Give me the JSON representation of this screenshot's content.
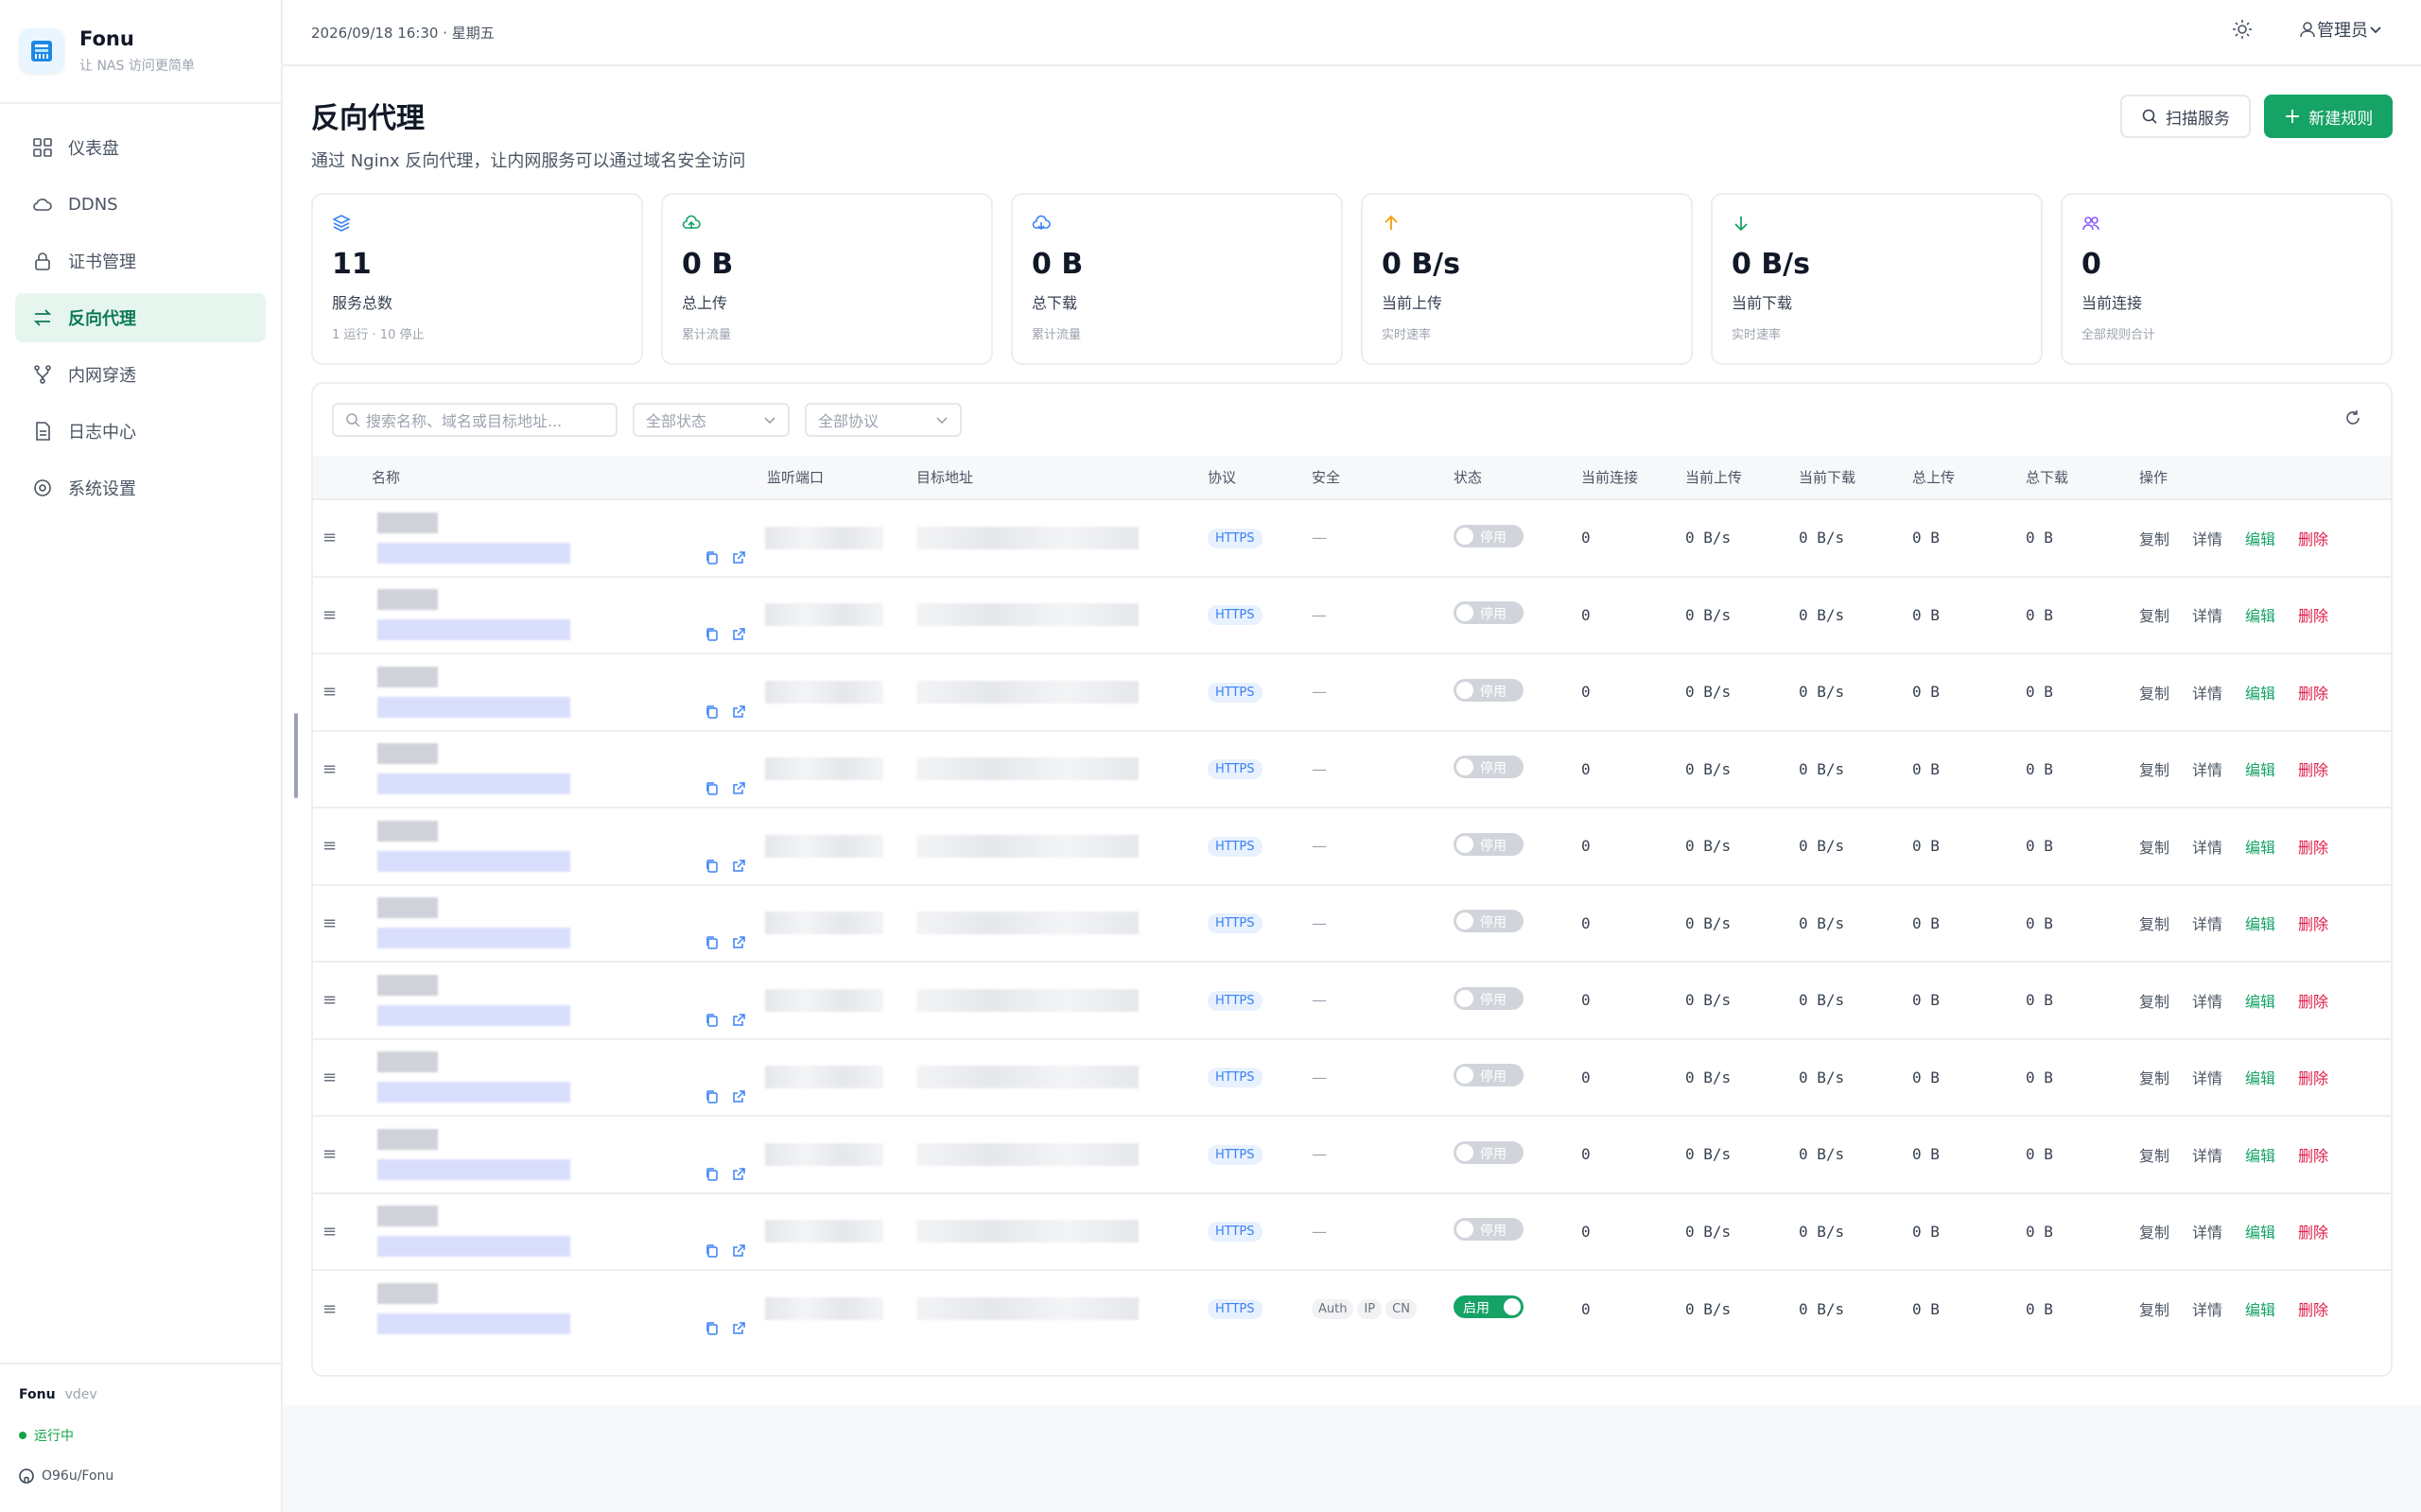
{
  "app": {
    "name": "Fonu",
    "tagline": "让 NAS 访问更简单"
  },
  "nav": [
    {
      "label": "仪表盘",
      "icon": "dashboard-icon"
    },
    {
      "label": "DDNS",
      "icon": "cloud-icon"
    },
    {
      "label": "证书管理",
      "icon": "lock-icon"
    },
    {
      "label": "反向代理",
      "icon": "swap-icon",
      "active": true
    },
    {
      "label": "内网穿透",
      "icon": "branch-icon"
    },
    {
      "label": "日志中心",
      "icon": "document-icon"
    },
    {
      "label": "系统设置",
      "icon": "gear-icon"
    }
  ],
  "footer": {
    "name": "Fonu",
    "version": "vdev",
    "status": "运行中",
    "repo": "O96u/Fonu"
  },
  "topbar": {
    "datetime": "2026/09/18 16:30 · 星期五",
    "user": "管理员"
  },
  "page": {
    "title": "反向代理",
    "subtitle": "通过 Nginx 反向代理，让内网服务可以通过域名安全访问",
    "scan_label": "扫描服务",
    "new_label": "新建规则"
  },
  "stats": [
    {
      "value": "11",
      "label": "服务总数",
      "sub": "1 运行 · 10 停止",
      "icon": "layers-icon",
      "color": "#3b82f6"
    },
    {
      "value": "0 B",
      "label": "总上传",
      "sub": "累计流量",
      "icon": "cloud-upload-icon",
      "color": "#16a366"
    },
    {
      "value": "0 B",
      "label": "总下载",
      "sub": "累计流量",
      "icon": "cloud-download-icon",
      "color": "#3b82f6"
    },
    {
      "value": "0 B/s",
      "label": "当前上传",
      "sub": "实时速率",
      "icon": "arrow-up-icon",
      "color": "#f59e0b"
    },
    {
      "value": "0 B/s",
      "label": "当前下载",
      "sub": "实时速率",
      "icon": "arrow-down-icon",
      "color": "#16a366"
    },
    {
      "value": "0",
      "label": "当前连接",
      "sub": "全部规则合计",
      "icon": "users-icon",
      "color": "#8b5cf6"
    }
  ],
  "filters": {
    "search_placeholder": "搜索名称、域名或目标地址...",
    "status": "全部状态",
    "protocol": "全部协议"
  },
  "table": {
    "columns": [
      "名称",
      "监听端口",
      "目标地址",
      "协议",
      "安全",
      "状态",
      "当前连接",
      "当前上传",
      "当前下载",
      "总上传",
      "总下载",
      "操作"
    ],
    "actions": {
      "copy": "复制",
      "detail": "详情",
      "edit": "编辑",
      "delete": "删除"
    },
    "rows": [
      {
        "protocol": "HTTPS",
        "security": "—",
        "status": "停用",
        "enabled": false,
        "conn": "0",
        "up": "0 B/s",
        "down": "0 B/s",
        "total_up": "0 B",
        "total_down": "0 B"
      },
      {
        "protocol": "HTTPS",
        "security": "—",
        "status": "停用",
        "enabled": false,
        "conn": "0",
        "up": "0 B/s",
        "down": "0 B/s",
        "total_up": "0 B",
        "total_down": "0 B"
      },
      {
        "protocol": "HTTPS",
        "security": "—",
        "status": "停用",
        "enabled": false,
        "conn": "0",
        "up": "0 B/s",
        "down": "0 B/s",
        "total_up": "0 B",
        "total_down": "0 B"
      },
      {
        "protocol": "HTTPS",
        "security": "—",
        "status": "停用",
        "enabled": false,
        "conn": "0",
        "up": "0 B/s",
        "down": "0 B/s",
        "total_up": "0 B",
        "total_down": "0 B"
      },
      {
        "protocol": "HTTPS",
        "security": "—",
        "status": "停用",
        "enabled": false,
        "conn": "0",
        "up": "0 B/s",
        "down": "0 B/s",
        "total_up": "0 B",
        "total_down": "0 B"
      },
      {
        "protocol": "HTTPS",
        "security": "—",
        "status": "停用",
        "enabled": false,
        "conn": "0",
        "up": "0 B/s",
        "down": "0 B/s",
        "total_up": "0 B",
        "total_down": "0 B"
      },
      {
        "protocol": "HTTPS",
        "security": "—",
        "status": "停用",
        "enabled": false,
        "conn": "0",
        "up": "0 B/s",
        "down": "0 B/s",
        "total_up": "0 B",
        "total_down": "0 B"
      },
      {
        "protocol": "HTTPS",
        "security": "—",
        "status": "停用",
        "enabled": false,
        "conn": "0",
        "up": "0 B/s",
        "down": "0 B/s",
        "total_up": "0 B",
        "total_down": "0 B"
      },
      {
        "protocol": "HTTPS",
        "security": "—",
        "status": "停用",
        "enabled": false,
        "conn": "0",
        "up": "0 B/s",
        "down": "0 B/s",
        "total_up": "0 B",
        "total_down": "0 B"
      },
      {
        "protocol": "HTTPS",
        "security": "—",
        "status": "停用",
        "enabled": false,
        "conn": "0",
        "up": "0 B/s",
        "down": "0 B/s",
        "total_up": "0 B",
        "total_down": "0 B"
      },
      {
        "protocol": "HTTPS",
        "security_chips": [
          "Auth",
          "IP",
          "CN"
        ],
        "status": "启用",
        "enabled": true,
        "conn": "0",
        "up": "0 B/s",
        "down": "0 B/s",
        "total_up": "0 B",
        "total_down": "0 B"
      }
    ]
  }
}
